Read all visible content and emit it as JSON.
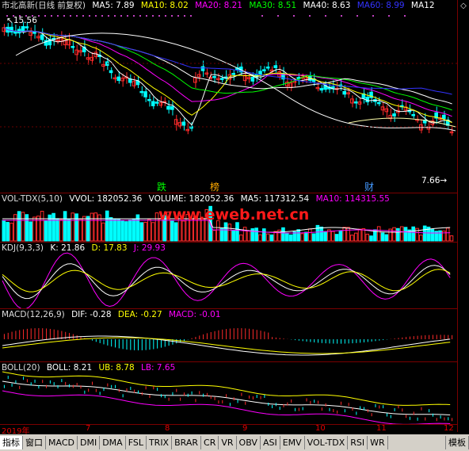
{
  "main": {
    "title": "市北高新(日线 前复权)",
    "ma": [
      {
        "label": "MA5: 7.89",
        "color": "#ffffff"
      },
      {
        "label": "MA10: 8.02",
        "color": "#ffff00"
      },
      {
        "label": "MA20: 8.21",
        "color": "#ff00ff"
      },
      {
        "label": "MA30: 8.51",
        "color": "#00ff00"
      },
      {
        "label": "MA40: 8.63",
        "color": "#ffffff"
      },
      {
        "label": "MA60: 8.99",
        "color": "#3333ff"
      },
      {
        "label": "MA12",
        "color": "#ffffff"
      }
    ],
    "high_label": "15.56",
    "low_label": "7.66",
    "events": [
      {
        "text": "跌",
        "color": "#00ff00"
      },
      {
        "text": "榜",
        "color": "#ffaa00"
      },
      {
        "text": "财",
        "color": "#4499ff"
      }
    ]
  },
  "vol": {
    "name": "VOL-TDX(5,10)",
    "items": [
      {
        "label": "VVOL: 182052.36",
        "color": "#ffffff"
      },
      {
        "label": "VOLUME: 182052.36",
        "color": "#ffffff"
      },
      {
        "label": "MA5: 117312.54",
        "color": "#ffffff"
      },
      {
        "label": "MA10: 114315.55",
        "color": "#ff00ff"
      }
    ]
  },
  "kdj": {
    "name": "KDJ(9,3,3)",
    "items": [
      {
        "label": "K: 21.86",
        "color": "#ffffff"
      },
      {
        "label": "D: 17.83",
        "color": "#ffff00"
      },
      {
        "label": "J: 29.93",
        "color": "#ff00ff"
      }
    ]
  },
  "macd": {
    "name": "MACD(12,26,9)",
    "items": [
      {
        "label": "DIF: -0.28",
        "color": "#ffffff"
      },
      {
        "label": "DEA: -0.27",
        "color": "#ffff00"
      },
      {
        "label": "MACD: -0.01",
        "color": "#ff00ff"
      }
    ]
  },
  "boll": {
    "name": "BOLL(20)",
    "items": [
      {
        "label": "BOLL: 8.21",
        "color": "#ffffff"
      },
      {
        "label": "UB: 8.78",
        "color": "#ffff00"
      },
      {
        "label": "LB: 7.65",
        "color": "#ff00ff"
      }
    ]
  },
  "watermark": "www.eweb.net.cn",
  "date_axis": [
    "2019年",
    "7",
    "8",
    "9",
    "10",
    "11",
    "12"
  ],
  "tabs": [
    "指标",
    "窗口",
    "MACD",
    "DMI",
    "DMA",
    "FSL",
    "TRIX",
    "BRAR",
    "CR",
    "VR",
    "OBV",
    "ASI",
    "EMV",
    "VOL-TDX",
    "RSI",
    "WR",
    "模板"
  ]
}
